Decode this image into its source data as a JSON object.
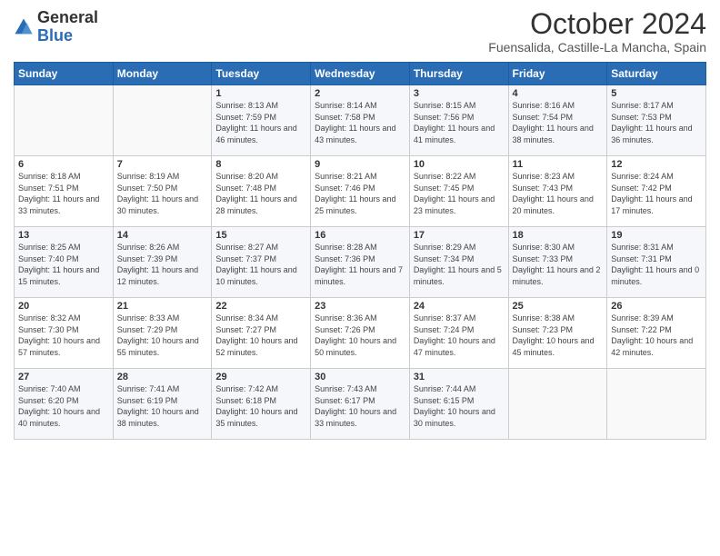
{
  "logo": {
    "general": "General",
    "blue": "Blue"
  },
  "title": "October 2024",
  "location": "Fuensalida, Castille-La Mancha, Spain",
  "headers": [
    "Sunday",
    "Monday",
    "Tuesday",
    "Wednesday",
    "Thursday",
    "Friday",
    "Saturday"
  ],
  "weeks": [
    [
      {
        "day": "",
        "info": ""
      },
      {
        "day": "",
        "info": ""
      },
      {
        "day": "1",
        "info": "Sunrise: 8:13 AM\nSunset: 7:59 PM\nDaylight: 11 hours and 46 minutes."
      },
      {
        "day": "2",
        "info": "Sunrise: 8:14 AM\nSunset: 7:58 PM\nDaylight: 11 hours and 43 minutes."
      },
      {
        "day": "3",
        "info": "Sunrise: 8:15 AM\nSunset: 7:56 PM\nDaylight: 11 hours and 41 minutes."
      },
      {
        "day": "4",
        "info": "Sunrise: 8:16 AM\nSunset: 7:54 PM\nDaylight: 11 hours and 38 minutes."
      },
      {
        "day": "5",
        "info": "Sunrise: 8:17 AM\nSunset: 7:53 PM\nDaylight: 11 hours and 36 minutes."
      }
    ],
    [
      {
        "day": "6",
        "info": "Sunrise: 8:18 AM\nSunset: 7:51 PM\nDaylight: 11 hours and 33 minutes."
      },
      {
        "day": "7",
        "info": "Sunrise: 8:19 AM\nSunset: 7:50 PM\nDaylight: 11 hours and 30 minutes."
      },
      {
        "day": "8",
        "info": "Sunrise: 8:20 AM\nSunset: 7:48 PM\nDaylight: 11 hours and 28 minutes."
      },
      {
        "day": "9",
        "info": "Sunrise: 8:21 AM\nSunset: 7:46 PM\nDaylight: 11 hours and 25 minutes."
      },
      {
        "day": "10",
        "info": "Sunrise: 8:22 AM\nSunset: 7:45 PM\nDaylight: 11 hours and 23 minutes."
      },
      {
        "day": "11",
        "info": "Sunrise: 8:23 AM\nSunset: 7:43 PM\nDaylight: 11 hours and 20 minutes."
      },
      {
        "day": "12",
        "info": "Sunrise: 8:24 AM\nSunset: 7:42 PM\nDaylight: 11 hours and 17 minutes."
      }
    ],
    [
      {
        "day": "13",
        "info": "Sunrise: 8:25 AM\nSunset: 7:40 PM\nDaylight: 11 hours and 15 minutes."
      },
      {
        "day": "14",
        "info": "Sunrise: 8:26 AM\nSunset: 7:39 PM\nDaylight: 11 hours and 12 minutes."
      },
      {
        "day": "15",
        "info": "Sunrise: 8:27 AM\nSunset: 7:37 PM\nDaylight: 11 hours and 10 minutes."
      },
      {
        "day": "16",
        "info": "Sunrise: 8:28 AM\nSunset: 7:36 PM\nDaylight: 11 hours and 7 minutes."
      },
      {
        "day": "17",
        "info": "Sunrise: 8:29 AM\nSunset: 7:34 PM\nDaylight: 11 hours and 5 minutes."
      },
      {
        "day": "18",
        "info": "Sunrise: 8:30 AM\nSunset: 7:33 PM\nDaylight: 11 hours and 2 minutes."
      },
      {
        "day": "19",
        "info": "Sunrise: 8:31 AM\nSunset: 7:31 PM\nDaylight: 11 hours and 0 minutes."
      }
    ],
    [
      {
        "day": "20",
        "info": "Sunrise: 8:32 AM\nSunset: 7:30 PM\nDaylight: 10 hours and 57 minutes."
      },
      {
        "day": "21",
        "info": "Sunrise: 8:33 AM\nSunset: 7:29 PM\nDaylight: 10 hours and 55 minutes."
      },
      {
        "day": "22",
        "info": "Sunrise: 8:34 AM\nSunset: 7:27 PM\nDaylight: 10 hours and 52 minutes."
      },
      {
        "day": "23",
        "info": "Sunrise: 8:36 AM\nSunset: 7:26 PM\nDaylight: 10 hours and 50 minutes."
      },
      {
        "day": "24",
        "info": "Sunrise: 8:37 AM\nSunset: 7:24 PM\nDaylight: 10 hours and 47 minutes."
      },
      {
        "day": "25",
        "info": "Sunrise: 8:38 AM\nSunset: 7:23 PM\nDaylight: 10 hours and 45 minutes."
      },
      {
        "day": "26",
        "info": "Sunrise: 8:39 AM\nSunset: 7:22 PM\nDaylight: 10 hours and 42 minutes."
      }
    ],
    [
      {
        "day": "27",
        "info": "Sunrise: 7:40 AM\nSunset: 6:20 PM\nDaylight: 10 hours and 40 minutes."
      },
      {
        "day": "28",
        "info": "Sunrise: 7:41 AM\nSunset: 6:19 PM\nDaylight: 10 hours and 38 minutes."
      },
      {
        "day": "29",
        "info": "Sunrise: 7:42 AM\nSunset: 6:18 PM\nDaylight: 10 hours and 35 minutes."
      },
      {
        "day": "30",
        "info": "Sunrise: 7:43 AM\nSunset: 6:17 PM\nDaylight: 10 hours and 33 minutes."
      },
      {
        "day": "31",
        "info": "Sunrise: 7:44 AM\nSunset: 6:15 PM\nDaylight: 10 hours and 30 minutes."
      },
      {
        "day": "",
        "info": ""
      },
      {
        "day": "",
        "info": ""
      }
    ]
  ]
}
